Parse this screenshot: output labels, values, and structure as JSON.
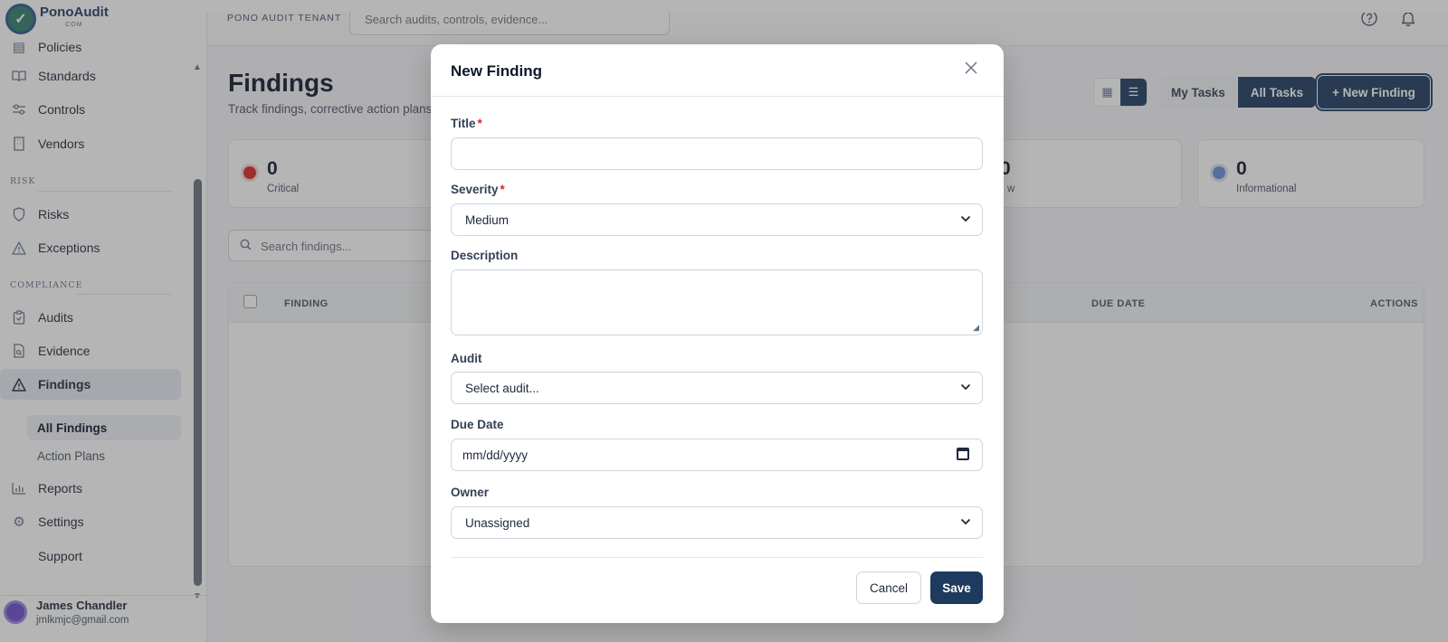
{
  "brand": {
    "name": "PonoAudit",
    "suffix": "COM"
  },
  "header": {
    "tenant": "PONO AUDIT TENANT",
    "search_placeholder": "Search audits, controls, evidence..."
  },
  "sidebar": {
    "partial_item": "Policies",
    "items_top": [
      {
        "label": "Standards",
        "icon": "book-icon"
      },
      {
        "label": "Controls",
        "icon": "sliders-icon"
      },
      {
        "label": "Vendors",
        "icon": "building-icon"
      }
    ],
    "section_risk": "RISK",
    "items_risk": [
      {
        "label": "Risks",
        "icon": "shield-icon"
      },
      {
        "label": "Exceptions",
        "icon": "warning-icon"
      }
    ],
    "section_compliance": "COMPLIANCE",
    "items_compliance": [
      {
        "label": "Audits",
        "icon": "clipboard-icon"
      },
      {
        "label": "Evidence",
        "icon": "file-search-icon"
      },
      {
        "label": "Findings",
        "icon": "warning-icon"
      }
    ],
    "sub_items": [
      {
        "label": "All Findings"
      },
      {
        "label": "Action Plans"
      }
    ],
    "items_bottom": [
      {
        "label": "Reports",
        "icon": "bar-chart-icon"
      },
      {
        "label": "Settings",
        "icon": "gear-icon"
      },
      {
        "label": "Support",
        "icon": ""
      }
    ],
    "user": {
      "name": "James Chandler",
      "email": "jmlkmjc@gmail.com"
    }
  },
  "main": {
    "title": "Findings",
    "subtitle": "Track findings, corrective action plans,",
    "toggle": {
      "my_tasks": "My Tasks",
      "all_tasks": "All Tasks"
    },
    "new_button": "+ New Finding",
    "stats": [
      {
        "value": "0",
        "label": "Critical",
        "color": "#dc2626"
      },
      {
        "value": "0",
        "label": "w",
        "color": "#64748b"
      },
      {
        "value": "0",
        "label": "Informational",
        "color": "#6b8fd6"
      }
    ],
    "search_placeholder": "Search findings...",
    "columns": {
      "finding": "FINDING",
      "due_date": "DUE DATE",
      "actions": "ACTIONS"
    }
  },
  "modal": {
    "title": "New Finding",
    "fields": {
      "title": {
        "label": "Title",
        "value": ""
      },
      "severity": {
        "label": "Severity",
        "value": "Medium"
      },
      "description": {
        "label": "Description",
        "value": ""
      },
      "audit": {
        "label": "Audit",
        "value": "Select audit..."
      },
      "due_date": {
        "label": "Due Date",
        "value": "mm/dd/yyyy"
      },
      "owner": {
        "label": "Owner",
        "value": "Unassigned"
      }
    },
    "required_mark": "*",
    "cancel": "Cancel",
    "save": "Save"
  },
  "colors": {
    "primary": "#1e3a5f",
    "required": "#dc2626"
  }
}
